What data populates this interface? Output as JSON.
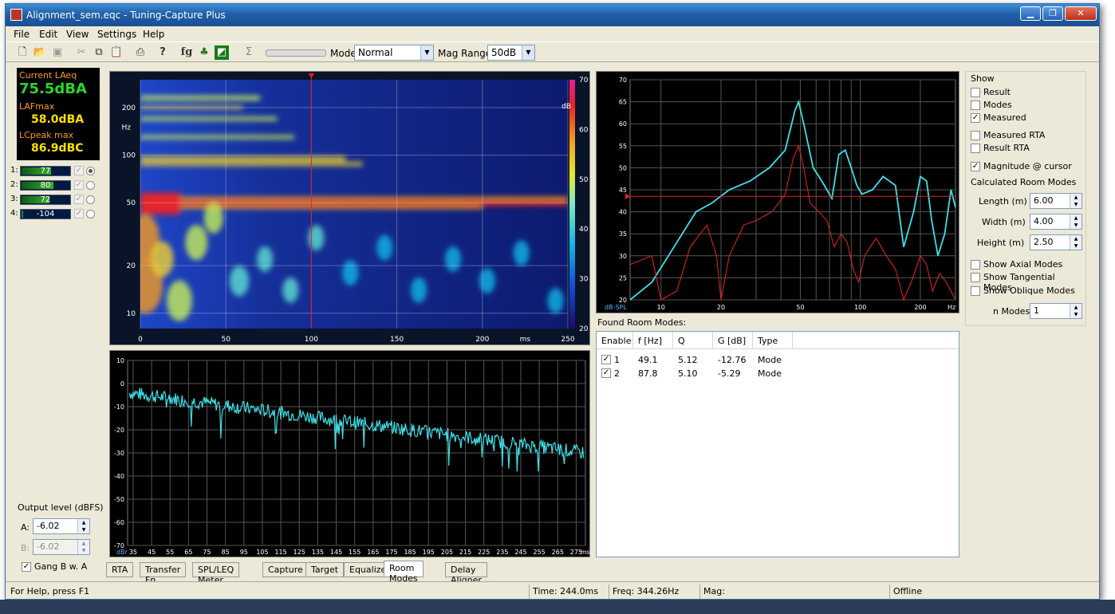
{
  "window": {
    "title": "Alignment_sem.eqc - Tuning-Capture Plus",
    "minimize": "▁",
    "restore": "❐",
    "close": "✕"
  },
  "menu": [
    "File",
    "Edit",
    "View",
    "Settings",
    "Help"
  ],
  "toolbar": {
    "mode_label": "Mode",
    "mode_value": "Normal",
    "magrange_label": "Mag Range",
    "magrange_value": "50dB",
    "icons": [
      "new-icon",
      "open-icon",
      "save-icon",
      "cut-icon",
      "copy-icon",
      "paste-icon",
      "print-icon",
      "help-icon",
      "fg-icon",
      "generator-icon",
      "graph-icon",
      "sum-icon"
    ]
  },
  "meters": {
    "current_label": "Current LAeq",
    "current_value": "75.5dBA",
    "lafmax_label": "LAFmax",
    "lafmax_value": "58.0dBA",
    "lcpeak_label": "LCpeak max",
    "lcpeak_value": "86.9dBC",
    "colors": {
      "current": "#2bd62b",
      "labels": "#ff9a1a",
      "values": "#ffe100"
    }
  },
  "channels": [
    {
      "num": "1:",
      "value": "77",
      "fill": 0.62,
      "checked": true,
      "radio": true
    },
    {
      "num": "2:",
      "value": "80",
      "fill": 0.66,
      "checked": true,
      "radio": false
    },
    {
      "num": "3:",
      "value": "72",
      "fill": 0.58,
      "checked": true,
      "radio": false
    },
    {
      "num": "4:",
      "value": "-104",
      "fill": 0.01,
      "checked": true,
      "radio": false
    }
  ],
  "output": {
    "label": "Output level (dBFS)",
    "a_label": "A:",
    "a_value": "-6.02",
    "b_label": "B:",
    "b_value": "-6.02",
    "gang_label": "Gang B w. A"
  },
  "spectrogram": {
    "y_ticks": [
      "200",
      "100",
      "50",
      "20",
      "10"
    ],
    "y_unit": "Hz",
    "x_ticks": [
      "0",
      "50",
      "100",
      "150",
      "200",
      "250"
    ],
    "x_unit": "ms",
    "scale_ticks": [
      "70",
      "60",
      "50",
      "40",
      "30",
      "20"
    ],
    "scale_unit": "dB"
  },
  "decay": {
    "y_ticks": [
      "10",
      "0",
      "-10",
      "-20",
      "-30",
      "-40",
      "-50",
      "-60",
      "-70"
    ],
    "y_unit": "dBr",
    "x_ticks": [
      "35",
      "45",
      "55",
      "65",
      "75",
      "85",
      "95",
      "105",
      "115",
      "125",
      "135",
      "145",
      "155",
      "165",
      "175",
      "185",
      "195",
      "205",
      "215",
      "225",
      "235",
      "245",
      "255",
      "265",
      "275"
    ],
    "x_unit": "ms"
  },
  "freqplot": {
    "y_ticks": [
      "70",
      "65",
      "60",
      "55",
      "50",
      "45",
      "40",
      "35",
      "30",
      "25",
      "20"
    ],
    "y_unit": "dB-SPL",
    "x_ticks": [
      "10",
      "20",
      "50",
      "100",
      "200"
    ],
    "x_unit": "Hz"
  },
  "room": {
    "title": "Found Room Modes:",
    "headers": [
      "Enable",
      "f [Hz]",
      "Q",
      "G [dB]",
      "Type"
    ],
    "rows": [
      {
        "enable": "1",
        "f": "49.1",
        "q": "5.12",
        "g": "-12.76",
        "type": "Mode"
      },
      {
        "enable": "2",
        "f": "87.8",
        "q": "5.10",
        "g": "-5.29",
        "type": "Mode"
      }
    ]
  },
  "show": {
    "title": "Show",
    "result": "Result",
    "modes": "Modes",
    "measured": "Measured",
    "measured_rta": "Measured RTA",
    "result_rta": "Result RTA",
    "magnitude_cursor": "Magnitude @ cursor",
    "calc_title": "Calculated Room Modes",
    "length_label": "Length (m)",
    "length_value": "6.00",
    "width_label": "Width (m)",
    "width_value": "4.00",
    "height_label": "Height (m)",
    "height_value": "2.50",
    "axial": "Show Axial Modes",
    "tangential": "Show Tangential Modes",
    "oblique": "Show Oblique Modes",
    "nmodes_label": "n Modes",
    "nmodes_value": "1"
  },
  "tabs": [
    "RTA",
    "Transfer Fn",
    "SPL/LEQ Meter",
    "Capture",
    "Target",
    "Equalizer",
    "Room Modes",
    "Delay Aligner"
  ],
  "status": {
    "help": "For Help, press F1",
    "time": "Time: 244.0ms",
    "freq": "Freq: 344.26Hz",
    "mag": "Mag:",
    "state": "Offline"
  }
}
